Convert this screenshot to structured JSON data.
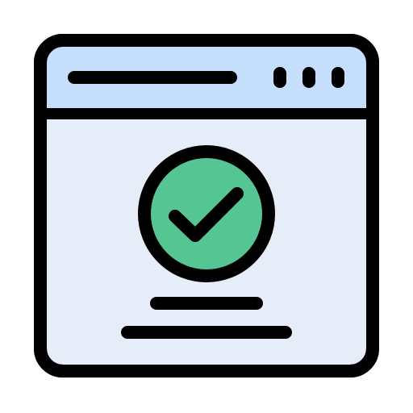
{
  "icon": {
    "name": "browser-window-success-icon",
    "colors": {
      "outline": "#000000",
      "title_bar": "#c4defc",
      "content_area": "#e6ecf8",
      "check_circle": "#55c593",
      "check_mark": "#000000",
      "background": "#ffffff"
    },
    "window_controls_count": 3,
    "text_lines_count": 2
  }
}
